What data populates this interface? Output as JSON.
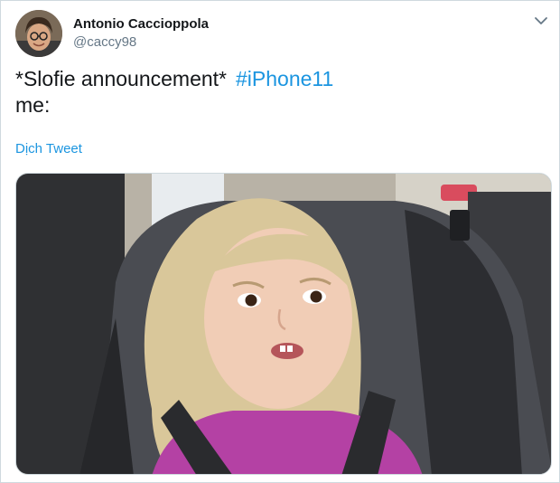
{
  "author": {
    "display_name": "Antonio Caccioppola",
    "handle": "@caccy98",
    "avatar_icon": "user-avatar-photo"
  },
  "tweet": {
    "line1": "*Slofie announcement*",
    "hashtag": "#iPhone11",
    "line2": "me:"
  },
  "actions": {
    "translate_label": "Dịch Tweet",
    "menu_icon": "chevron-down-icon"
  },
  "media": {
    "description_icon": "meme-photo"
  },
  "colors": {
    "link": "#1b95e0",
    "text": "#14171a",
    "muted": "#657786",
    "border": "#cfd9de"
  }
}
